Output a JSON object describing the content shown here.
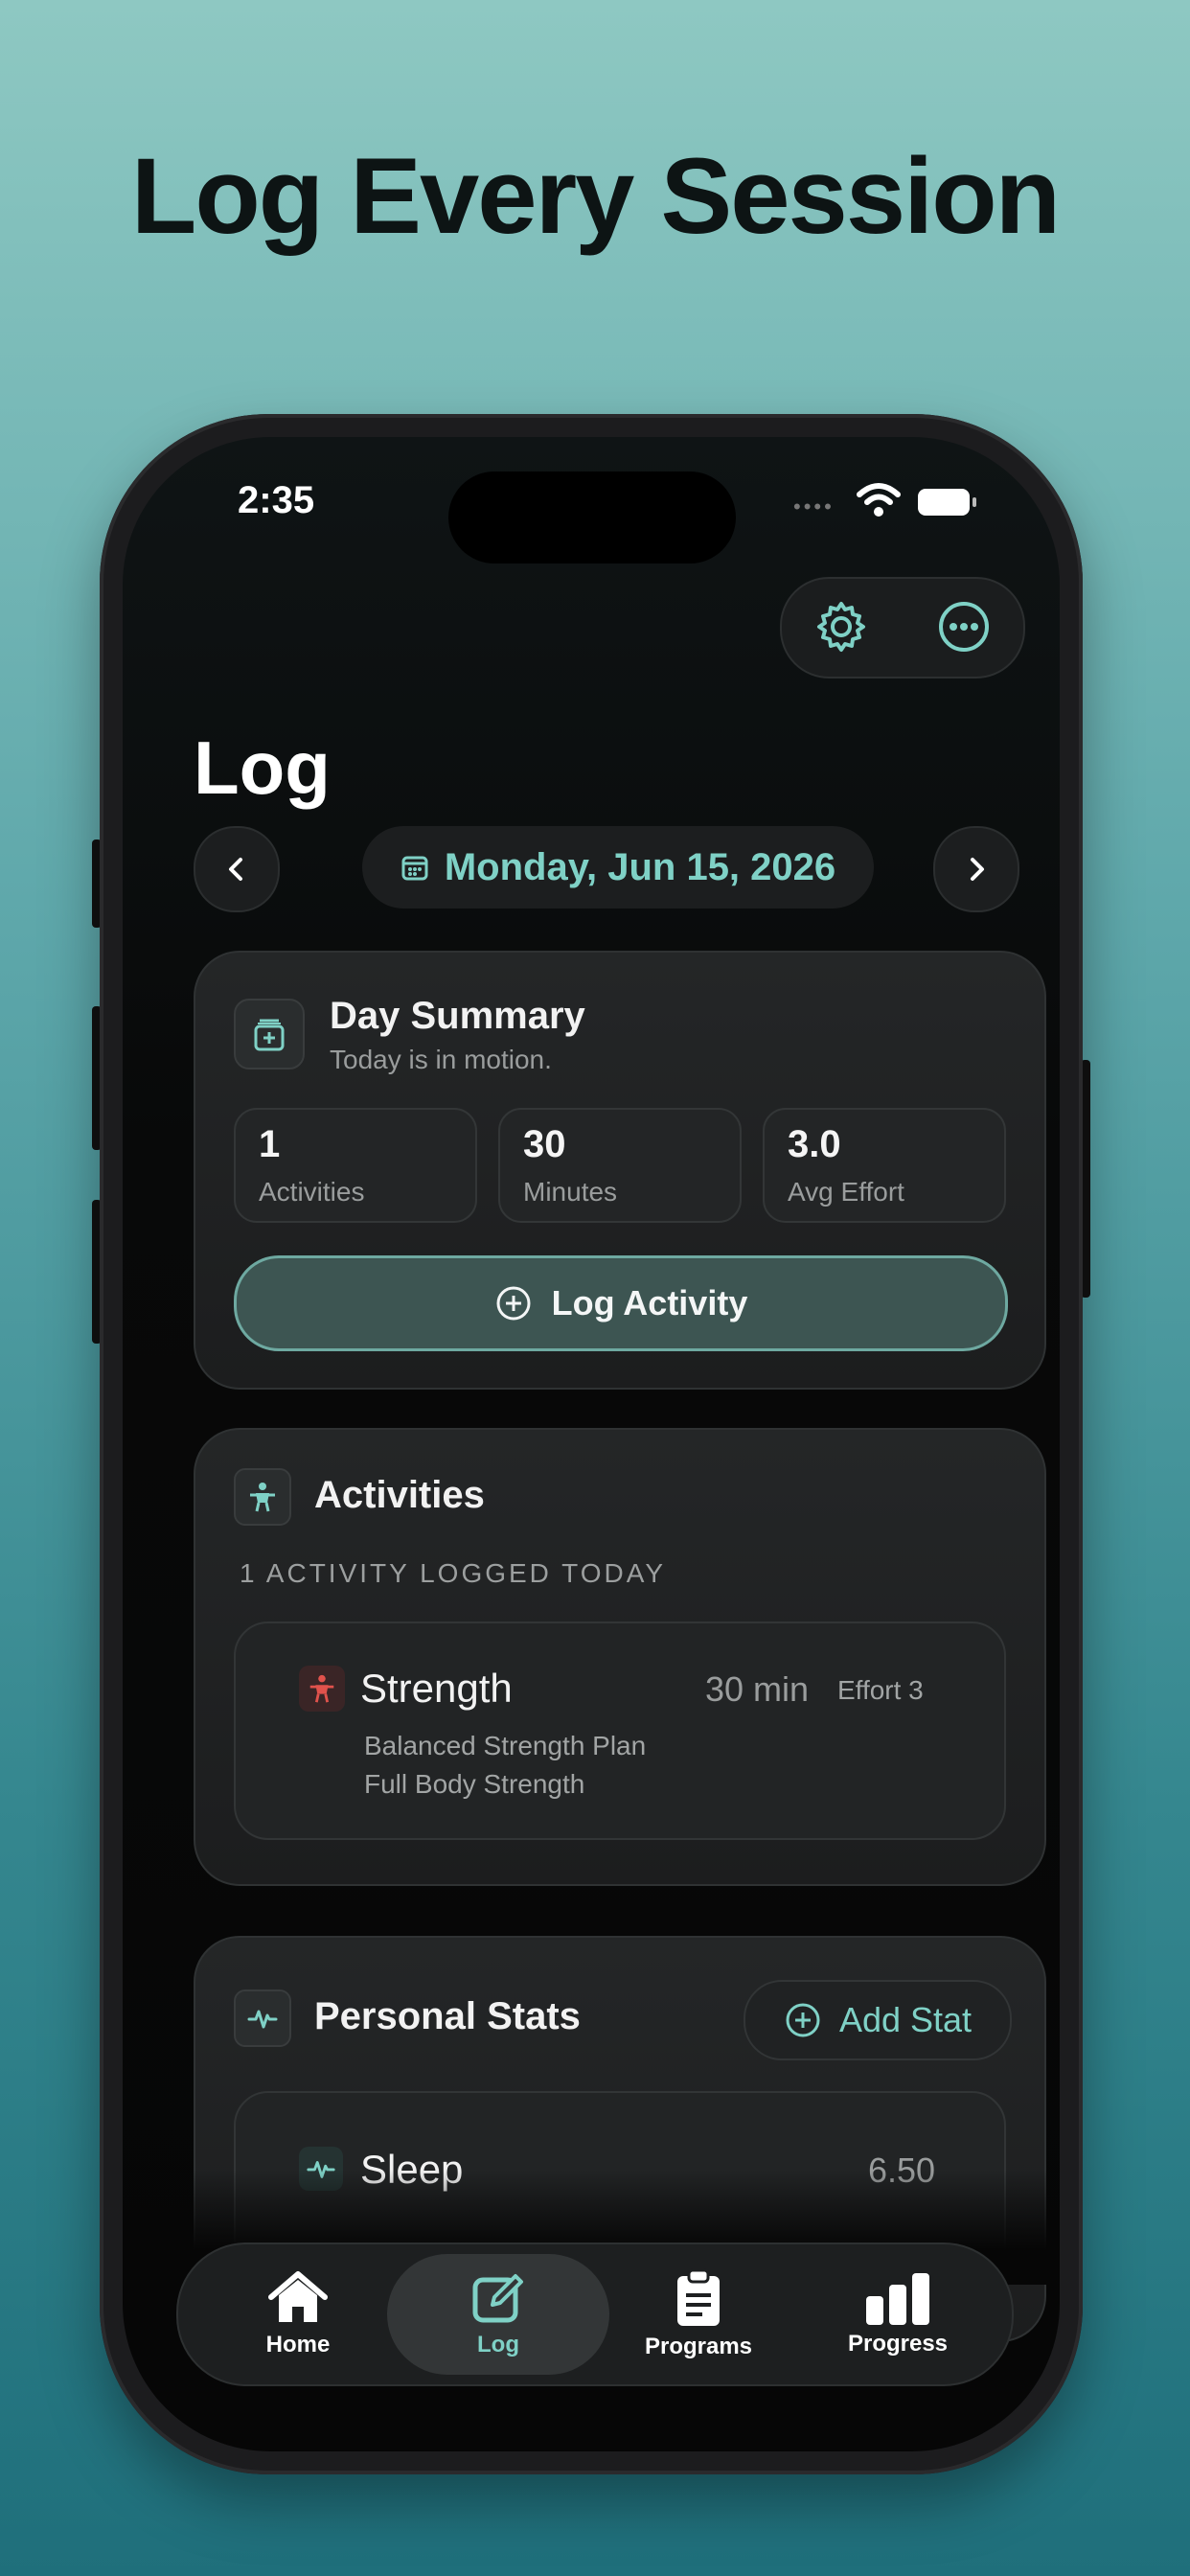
{
  "headline": "Log Every Session",
  "status_bar": {
    "time": "2:35",
    "signal_dots": "••••"
  },
  "header": {
    "title": "Log",
    "settings_icon": "gear-icon",
    "more_icon": "ellipsis-circle-icon"
  },
  "date_nav": {
    "date": "Monday, Jun 15, 2026",
    "prev_icon": "chevron-left-icon",
    "next_icon": "chevron-right-icon"
  },
  "day_summary": {
    "title": "Day Summary",
    "subtitle": "Today is in motion.",
    "stats": [
      {
        "value": "1",
        "label": "Activities"
      },
      {
        "value": "30",
        "label": "Minutes"
      },
      {
        "value": "3.0",
        "label": "Avg Effort"
      }
    ],
    "log_button": "Log Activity"
  },
  "activities": {
    "title": "Activities",
    "count_label": "1 ACTIVITY LOGGED TODAY",
    "items": [
      {
        "name": "Strength",
        "duration": "30 min",
        "effort": "Effort 3",
        "plan": "Balanced Strength Plan",
        "workout": "Full Body Strength"
      }
    ]
  },
  "personal_stats": {
    "title": "Personal Stats",
    "add_button": "Add Stat",
    "items": [
      {
        "name": "Sleep",
        "value": "6.50"
      }
    ]
  },
  "tabs": [
    {
      "label": "Home",
      "icon": "house-icon"
    },
    {
      "label": "Log",
      "icon": "pencil-square-icon",
      "active": true
    },
    {
      "label": "Programs",
      "icon": "clipboard-icon"
    },
    {
      "label": "Progress",
      "icon": "bar-chart-icon"
    }
  ],
  "colors": {
    "accent": "#7fd1c6",
    "strength": "#e0524c",
    "background": "#060606"
  }
}
